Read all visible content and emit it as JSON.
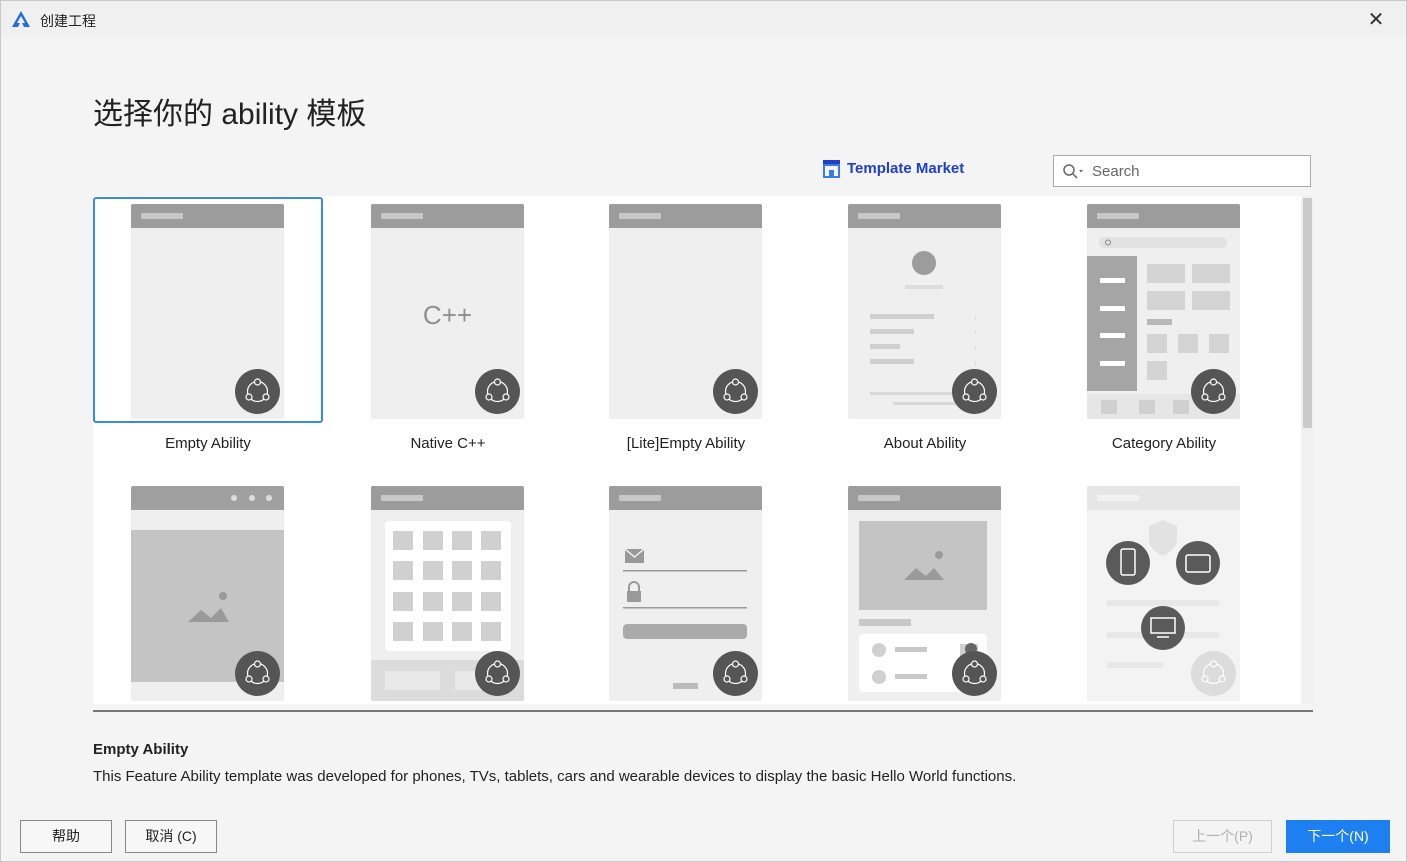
{
  "window": {
    "title": "创建工程",
    "close_glyph": "✕"
  },
  "page": {
    "heading": "选择你的 ability 模板"
  },
  "toolbar": {
    "market_label": "Template Market",
    "search_placeholder": "Search"
  },
  "templates": [
    {
      "label": "Empty Ability",
      "selected": true,
      "kind": "empty"
    },
    {
      "label": "Native C++",
      "selected": false,
      "kind": "native-cpp"
    },
    {
      "label": "[Lite]Empty Ability",
      "selected": false,
      "kind": "empty"
    },
    {
      "label": "About Ability",
      "selected": false,
      "kind": "about"
    },
    {
      "label": "Category Ability",
      "selected": false,
      "kind": "category"
    },
    {
      "label": "",
      "selected": false,
      "kind": "image-viewer"
    },
    {
      "label": "",
      "selected": false,
      "kind": "grid"
    },
    {
      "label": "",
      "selected": false,
      "kind": "login"
    },
    {
      "label": "",
      "selected": false,
      "kind": "list-detail"
    },
    {
      "label": "",
      "selected": false,
      "kind": "multi-device"
    }
  ],
  "cpp_glyph": "C++",
  "description": {
    "title": "Empty Ability",
    "text": "This Feature Ability template was developed for phones, TVs, tablets, cars and wearable devices to display the basic Hello World functions."
  },
  "buttons": {
    "help": "帮助",
    "cancel": "取消 (C)",
    "prev": "上一个(P)",
    "next": "下一个(N)"
  },
  "colors": {
    "accent": "#1d7ff0",
    "selection_border": "#3b8be6",
    "market_link": "#1e3fc7",
    "thumb_header": "#9c9c9c",
    "badge": "#555555"
  },
  "icons": {
    "app": "harmony-logo-icon",
    "market": "store-icon",
    "search": "search-icon",
    "badge": "ability-hub-icon"
  }
}
